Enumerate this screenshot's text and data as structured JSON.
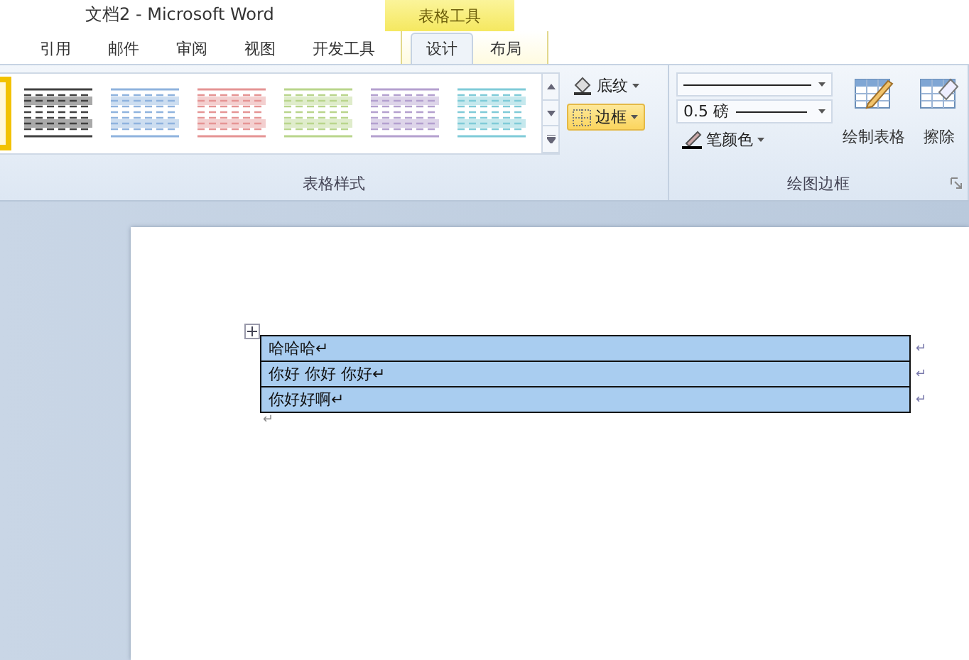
{
  "window": {
    "title": "文档2 - Microsoft Word",
    "context_title": "表格工具"
  },
  "tabs": [
    {
      "label": "引用",
      "selected": false
    },
    {
      "label": "邮件",
      "selected": false
    },
    {
      "label": "审阅",
      "selected": false
    },
    {
      "label": "视图",
      "selected": false
    },
    {
      "label": "开发工具",
      "selected": false
    }
  ],
  "context_tabs": [
    {
      "label": "设计",
      "selected": true
    },
    {
      "label": "布局",
      "selected": false
    }
  ],
  "table_styles": {
    "label": "表格样式",
    "items": [
      {
        "kind": "partial",
        "selected": true
      },
      {
        "kind": "style",
        "color": "#404040",
        "selected": false
      },
      {
        "kind": "style",
        "color": "#8fb3de",
        "selected": false
      },
      {
        "kind": "style",
        "color": "#e59494",
        "selected": false
      },
      {
        "kind": "style",
        "color": "#b9d58c",
        "selected": false
      },
      {
        "kind": "style",
        "color": "#b4a0cf",
        "selected": false
      },
      {
        "kind": "style",
        "color": "#7fcbd8",
        "selected": false
      }
    ],
    "shading": {
      "label": "底纹"
    },
    "borders": {
      "label": "边框",
      "on": true
    }
  },
  "draw_borders": {
    "label": "绘图边框",
    "line_weight": "0.5 磅",
    "pen_color": "笔颜色",
    "draw_table": "绘制表格",
    "eraser": "擦除"
  },
  "document": {
    "rows": [
      {
        "text": "哈哈哈↵",
        "end": "↵"
      },
      {
        "text": "你好 你好 你好↵",
        "end": "↵"
      },
      {
        "text": "你好好啊↵",
        "end": "↵"
      }
    ],
    "after": "↵"
  }
}
